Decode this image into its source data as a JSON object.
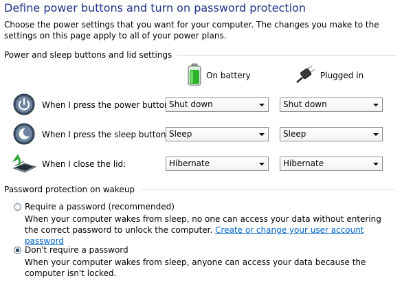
{
  "page": {
    "title": "Define power buttons and turn on password protection",
    "intro": "Choose the power settings that you want for your computer. The changes you make to the settings on this page apply to all of your power plans."
  },
  "power_section": {
    "header": "Power and sleep buttons and lid settings",
    "columns": {
      "battery": "On battery",
      "plugged": "Plugged in"
    },
    "rows": [
      {
        "label": "When I press the power button:",
        "icon": "power-button-icon",
        "on_battery": "Shut down",
        "plugged_in": "Shut down"
      },
      {
        "label": "When I press the sleep button:",
        "icon": "sleep-button-icon",
        "on_battery": "Sleep",
        "plugged_in": "Sleep"
      },
      {
        "label": "When I close the lid:",
        "icon": "laptop-lid-icon",
        "on_battery": "Hibernate",
        "plugged_in": "Hibernate"
      }
    ]
  },
  "password_section": {
    "header": "Password protection on wakeup",
    "options": [
      {
        "label": "Require a password (recommended)",
        "checked": false,
        "desc": "When your computer wakes from sleep, no one can access your data without entering the correct password to unlock the computer.",
        "link": "Create or change your user account password"
      },
      {
        "label": "Don't require a password",
        "checked": true,
        "desc": "When your computer wakes from sleep, anyone can access your data because the computer isn't locked."
      }
    ]
  },
  "colors": {
    "title": "#1e3287",
    "link": "#0066cc",
    "separator": "#d5dfe5"
  }
}
